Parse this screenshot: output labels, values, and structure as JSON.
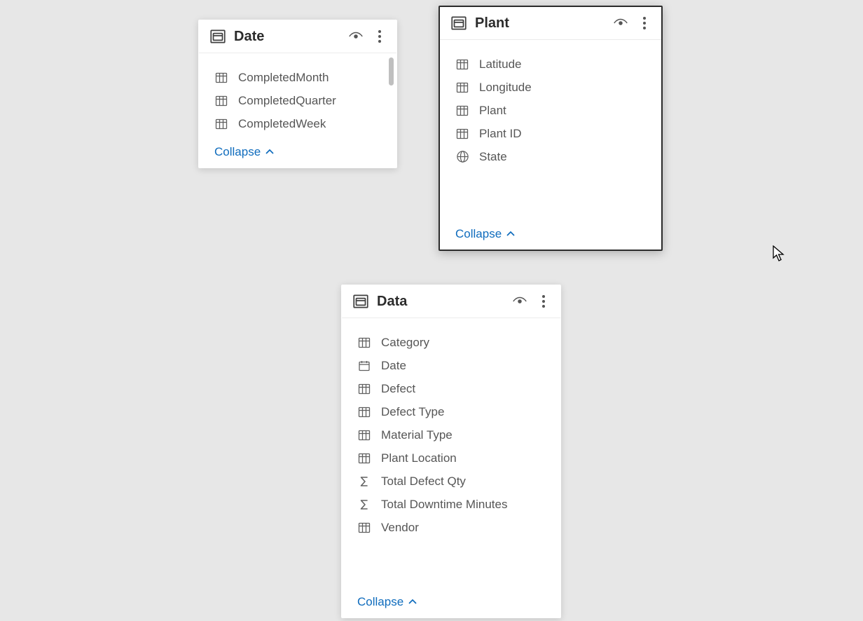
{
  "collapse_label": "Collapse",
  "tables": {
    "date": {
      "title": "Date",
      "fields": [
        {
          "icon": "column",
          "label": "CompletedMonth"
        },
        {
          "icon": "column",
          "label": "CompletedQuarter"
        },
        {
          "icon": "column",
          "label": "CompletedWeek"
        }
      ]
    },
    "plant": {
      "title": "Plant",
      "fields": [
        {
          "icon": "column",
          "label": "Latitude"
        },
        {
          "icon": "column",
          "label": "Longitude"
        },
        {
          "icon": "column",
          "label": "Plant"
        },
        {
          "icon": "column",
          "label": "Plant ID"
        },
        {
          "icon": "globe",
          "label": "State"
        }
      ]
    },
    "data": {
      "title": "Data",
      "fields": [
        {
          "icon": "column",
          "label": "Category"
        },
        {
          "icon": "calendar",
          "label": "Date"
        },
        {
          "icon": "column",
          "label": "Defect"
        },
        {
          "icon": "column",
          "label": "Defect Type"
        },
        {
          "icon": "column",
          "label": "Material Type"
        },
        {
          "icon": "column",
          "label": "Plant Location"
        },
        {
          "icon": "sigma",
          "label": "Total Defect Qty"
        },
        {
          "icon": "sigma",
          "label": "Total Downtime Minutes"
        },
        {
          "icon": "column",
          "label": "Vendor"
        }
      ]
    }
  }
}
